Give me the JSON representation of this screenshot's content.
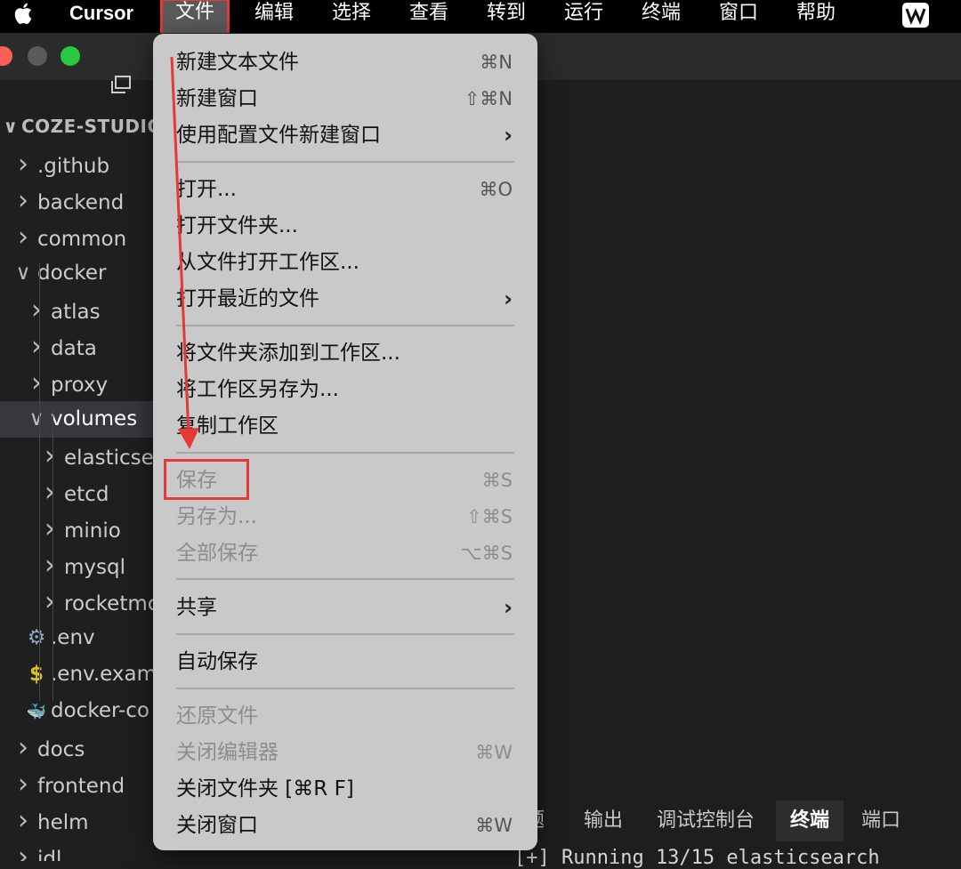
{
  "menubar": {
    "app_name": "Cursor",
    "items": [
      "文件",
      "编辑",
      "选择",
      "查看",
      "转到",
      "运行",
      "终端",
      "窗口",
      "帮助"
    ]
  },
  "explorer": {
    "root": "COZE-STUDIO-",
    "rows": [
      {
        "label": ".github",
        "icon": "chevron-right"
      },
      {
        "label": "backend",
        "icon": "chevron-right"
      },
      {
        "label": "common",
        "icon": "chevron-right"
      },
      {
        "label": "docker",
        "icon": "chevron-down"
      },
      {
        "label": "atlas",
        "icon": "chevron-right"
      },
      {
        "label": "data",
        "icon": "chevron-right"
      },
      {
        "label": "proxy",
        "icon": "chevron-right"
      },
      {
        "label": "volumes",
        "icon": "chevron-down"
      },
      {
        "label": "elasticse",
        "icon": "chevron-right"
      },
      {
        "label": "etcd",
        "icon": "chevron-right"
      },
      {
        "label": "minio",
        "icon": "chevron-right"
      },
      {
        "label": "mysql",
        "icon": "chevron-right"
      },
      {
        "label": "rocketmc",
        "icon": "chevron-right"
      },
      {
        "label": ".env",
        "icon": "gear-icon"
      },
      {
        "label": ".env.exam",
        "icon": "dollar-icon"
      },
      {
        "label": "docker-co",
        "icon": "docker-icon"
      },
      {
        "label": "docs",
        "icon": "chevron-right"
      },
      {
        "label": "frontend",
        "icon": "chevron-right"
      },
      {
        "label": "helm",
        "icon": "chevron-right"
      },
      {
        "label": "idl",
        "icon": "chevron-right"
      }
    ]
  },
  "file_menu": {
    "items": [
      {
        "label": "新建文本文件",
        "shortcut": "⌘N",
        "disabled": false
      },
      {
        "label": "新建窗口",
        "shortcut": "⇧⌘N",
        "disabled": false
      },
      {
        "label": "使用配置文件新建窗口",
        "shortcut": "",
        "submenu": true,
        "disabled": false
      },
      {
        "label": "打开...",
        "shortcut": "⌘O",
        "disabled": false
      },
      {
        "label": "打开文件夹...",
        "shortcut": "",
        "disabled": false
      },
      {
        "label": "从文件打开工作区...",
        "shortcut": "",
        "disabled": false
      },
      {
        "label": "打开最近的文件",
        "shortcut": "",
        "submenu": true,
        "disabled": false
      },
      {
        "label": "将文件夹添加到工作区...",
        "shortcut": "",
        "disabled": false
      },
      {
        "label": "将工作区另存为...",
        "shortcut": "",
        "disabled": false
      },
      {
        "label": "复制工作区",
        "shortcut": "",
        "disabled": false
      },
      {
        "label": "保存",
        "shortcut": "⌘S",
        "disabled": true
      },
      {
        "label": "另存为...",
        "shortcut": "⇧⌘S",
        "disabled": true
      },
      {
        "label": "全部保存",
        "shortcut": "⌥⌘S",
        "disabled": true
      },
      {
        "label": "共享",
        "shortcut": "",
        "submenu": true,
        "disabled": false
      },
      {
        "label": "自动保存",
        "shortcut": "",
        "disabled": false
      },
      {
        "label": "还原文件",
        "shortcut": "",
        "disabled": true
      },
      {
        "label": "关闭编辑器",
        "shortcut": "⌘W",
        "disabled": true
      },
      {
        "label": "关闭文件夹 [⌘R F]",
        "shortcut": "",
        "disabled": false
      },
      {
        "label": "关闭窗口",
        "shortcut": "⌘W",
        "disabled": false
      }
    ]
  },
  "panel": {
    "tabs": [
      "题",
      "输出",
      "调试控制台",
      "终端",
      "端口"
    ],
    "active_tab": "终端",
    "terminal_text": "[+] Running 13/15 elasticsearch"
  },
  "colors": {
    "highlight": "#e53935",
    "menu_bg": "#c9c9c9"
  }
}
